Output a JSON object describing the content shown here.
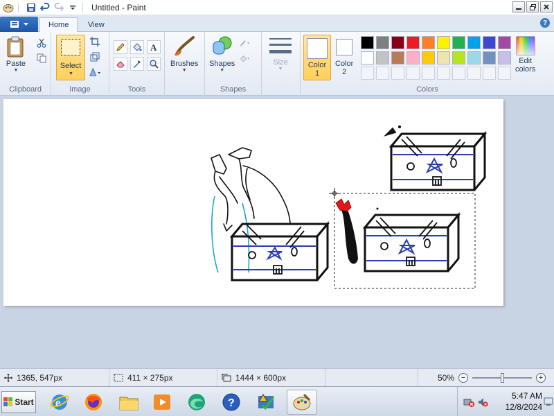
{
  "window": {
    "title": "Untitled - Paint"
  },
  "tabs": [
    {
      "label": "Home"
    },
    {
      "label": "View"
    }
  ],
  "ribbon": {
    "clipboard": {
      "group_label": "Clipboard",
      "paste_label": "Paste"
    },
    "image": {
      "group_label": "Image",
      "select_label": "Select"
    },
    "tools": {
      "group_label": "Tools"
    },
    "brushes": {
      "label": "Brushes"
    },
    "shapes": {
      "group_label": "Shapes",
      "label": "Shapes"
    },
    "size": {
      "label": "Size"
    },
    "colors": {
      "group_label": "Colors",
      "color1_label": "Color\n1",
      "color2_label": "Color\n2",
      "edit_colors_label": "Edit\ncolors",
      "palette_row1": [
        "#000000",
        "#7f7f7f",
        "#880015",
        "#ed1c24",
        "#ff7f27",
        "#fff200",
        "#22b14c",
        "#00a2e8",
        "#3f48cc",
        "#a349a4"
      ],
      "palette_row2": [
        "#ffffff",
        "#c3c3c3",
        "#b97a57",
        "#ffaec9",
        "#ffc90e",
        "#efe4b0",
        "#b5e61d",
        "#99d9ea",
        "#7092be",
        "#c8bfe7"
      ]
    }
  },
  "statusbar": {
    "cursor_pos": "1365, 547px",
    "selection_size": "411 × 275px",
    "image_size": "1444 × 600px",
    "zoom": "50%",
    "zoom_fraction": 0.5
  },
  "taskbar": {
    "start_label": "Start",
    "clock_time": "5:47 AM",
    "clock_date": "12/8/2024"
  },
  "canvas": {
    "drawing_color": "#2a3bb5",
    "accent_red": "#e01818",
    "accent_cyan": "#1aa6c8"
  }
}
